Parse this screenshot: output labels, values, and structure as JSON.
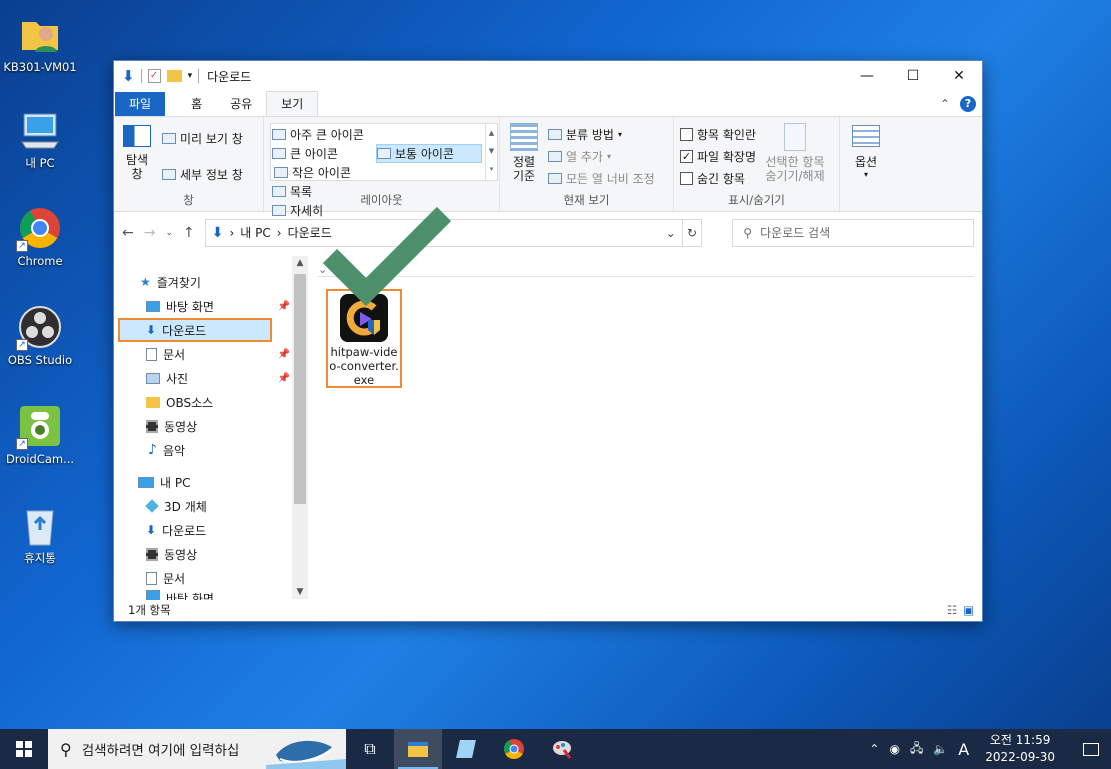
{
  "desktop": {
    "icons": [
      {
        "label": "KB301-VM01"
      },
      {
        "label": "내 PC"
      },
      {
        "label": "Chrome"
      },
      {
        "label": "OBS Studio"
      },
      {
        "label": "DroidCam..."
      },
      {
        "label": "휴지통"
      }
    ]
  },
  "window": {
    "title": "다운로드",
    "tabs": {
      "file": "파일",
      "home": "홈",
      "share": "공유",
      "view": "보기"
    },
    "ribbon": {
      "pane": {
        "nav_pane": "탐색\n창",
        "preview": "미리 보기 창",
        "details": "세부 정보 창",
        "label": "창"
      },
      "layout": {
        "xl_icons": "아주 큰 아이콘",
        "large_icons": "큰 아이콘",
        "medium_icons": "보통 아이콘",
        "small_icons": "작은 아이콘",
        "list": "목록",
        "details": "자세히",
        "label": "레이아웃"
      },
      "current_view": {
        "sort": "정렬\n기준",
        "group_by": "분류 방법",
        "add_columns": "열 추가",
        "fit_columns": "모든 열 너비 조정",
        "label": "현재 보기"
      },
      "show_hide": {
        "item_checkboxes": "항목 확인란",
        "extensions": "파일 확장명",
        "hidden_items": "숨긴 항목",
        "hide_selected": "선택한 항목\n숨기기/해제",
        "options": "옵션",
        "label": "표시/숨기기"
      }
    },
    "address": {
      "crumbs": [
        "내 PC",
        "다운로드"
      ],
      "search_placeholder": "다운로드 검색"
    },
    "nav": {
      "quick_access": "즐겨찾기",
      "items": [
        {
          "label": "바탕 화면"
        },
        {
          "label": "다운로드"
        },
        {
          "label": "문서"
        },
        {
          "label": "사진"
        },
        {
          "label": "OBS소스"
        },
        {
          "label": "동영상"
        },
        {
          "label": "음악"
        }
      ],
      "this_pc": "내 PC",
      "pc_items": [
        {
          "label": "3D 개체"
        },
        {
          "label": "다운로드"
        },
        {
          "label": "동영상"
        },
        {
          "label": "문서"
        },
        {
          "label": "바탕 화면"
        }
      ]
    },
    "content": {
      "file": {
        "name": "hitpaw-video-converter.exe"
      }
    },
    "status": {
      "count": "1개 항목"
    }
  },
  "taskbar": {
    "search_placeholder": "검색하려면 여기에 입력하십",
    "ime": "A",
    "clock": {
      "time": "오전 11:59",
      "date": "2022-09-30"
    }
  },
  "colors": {
    "accent": "#1a66c4",
    "highlight": "#f08a35",
    "check": "#4e8f6c"
  }
}
